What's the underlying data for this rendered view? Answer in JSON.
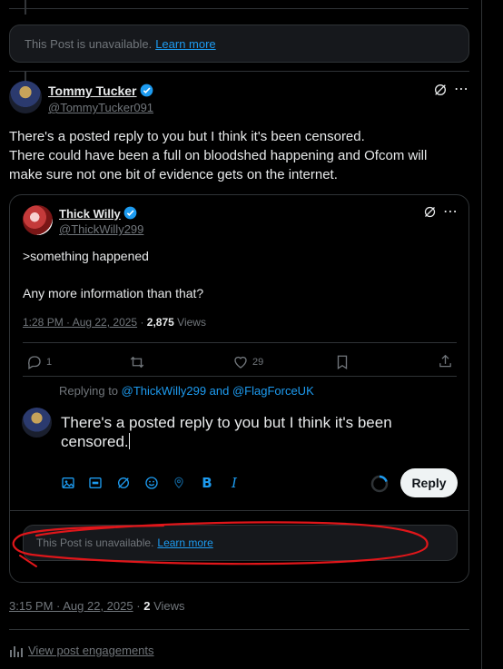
{
  "top_unavailable": {
    "text": "This Post is unavailable.",
    "link": "Learn more"
  },
  "main_post": {
    "author_name": "Tommy Tucker",
    "author_handle": "@TommyTucker091",
    "text_line1": "There's a posted reply to you but I think it's been censored.",
    "text_line2": "There could have been a full on bloodshed happening and Ofcom will",
    "text_line3": "make sure not one bit of evidence gets on the internet."
  },
  "quoted_post": {
    "author_name": "Thick Willy",
    "author_handle": "@ThickWilly299",
    "text_line1": ">something happened",
    "text_line2": "Any more information than that?",
    "timestamp": "1:28 PM · Aug 22, 2025",
    "views_count": "2,875",
    "views_label": "Views",
    "replies": "1",
    "likes": "29"
  },
  "composer": {
    "replying_prefix": "Replying to",
    "replying_to": "@ThickWilly299 and @FlagForceUK",
    "draft_line1": "There's a posted reply to you but I think it's been",
    "draft_line2": "censored.",
    "reply_button": "Reply",
    "tools": [
      "image-icon",
      "gif-icon",
      "grok-icon",
      "emoji-icon",
      "location-icon",
      "bold-icon",
      "italic-icon"
    ]
  },
  "inner_unavailable": {
    "text": "This Post is unavailable.",
    "link": "Learn more"
  },
  "footer": {
    "timestamp": "3:15 PM · Aug 22, 2025",
    "separator": "·",
    "views_count": "2",
    "views_label": "Views",
    "engagements_link": "View post engagements"
  },
  "colors": {
    "accent": "#1d9bf0",
    "annotation": "#e0161a",
    "background": "#000000"
  }
}
